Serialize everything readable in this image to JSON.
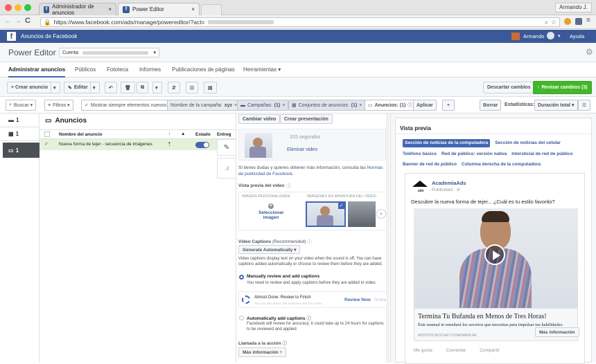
{
  "browser": {
    "tabs": [
      {
        "label": "Administrador de anuncios"
      },
      {
        "label": "Power Editor"
      }
    ],
    "url": "https://www.facebook.com/ads/manage/powereditor/?act=",
    "user": "Armando J."
  },
  "fbbar": {
    "title": "Anuncios de Facebook",
    "user": "Armando",
    "help": "Ayuda"
  },
  "pe": {
    "title": "Power Editor",
    "account_label": "Cuenta:"
  },
  "menu": [
    "Administrar anuncios",
    "Públicos",
    "Fototeca",
    "Informes",
    "Publicaciones de páginas",
    "Herramientas ▾"
  ],
  "toolbar": {
    "create": "+ Crear anuncio",
    "edit": "Editar",
    "discard": "Descartar cambios",
    "review": "Revisar cambios (3)"
  },
  "filters": {
    "search": "Buscar ▾",
    "filters": "Filtros ▾",
    "always_show": "Mostrar siempre elementos nuevos",
    "campaign_name": "Nombre de la campaña:",
    "campaign_name_val": "xyz",
    "campaigns": "Campañas:",
    "campaigns_val": "(1)",
    "adsets": "Conjuntos de anuncios:",
    "adsets_val": "(1)",
    "ads": "Anuncios: (1)",
    "apply": "Aplicar",
    "clear": "Borrar",
    "stats": "Estadísticas:",
    "stats_val": "Duración total ▾"
  },
  "left": {
    "count1": "1",
    "count2": "1",
    "count3": "1"
  },
  "adlist": {
    "title": "Anuncios",
    "headers": [
      "Nombre del anuncio",
      "Estado",
      "Entreg"
    ],
    "row": {
      "name": "Nueva forma de tejer - secuencia de imágenes"
    }
  },
  "editor": {
    "change_video": "Cambiar video",
    "create_presentation": "Crear presentación",
    "seconds": "· 315 segundos",
    "remove": "Eliminar video",
    "help_text": "Si tienes dudas y quieres obtener más información, consulta las",
    "help_link": "Normas de publicidad de Facebook.",
    "preview_label": "Vista previa del video",
    "custom_image": "IMAGEN PERSONALIZADA",
    "thumbs": "IMÁGENES EN MINIATURA DEL VIDEO",
    "select_image": "Seleccionar imagen",
    "captions_label": "Video Captions",
    "captions_rec": "(Recommended)",
    "captions_select": "Generate Automatically ▾",
    "captions_desc": "Video captions display text on your video when the sound is off. You can have captions added automatically or choose to review them before they are added.",
    "opt1_title": "Manually review and add captions",
    "opt1_desc": "You need to review and apply captions before they are added to video.",
    "done_title": "Almost Done: Review to Finish",
    "done_sub": "You can also share with someone else for review",
    "review_now": "Review Now",
    "share": "Share",
    "opt2_title": "Automatically add captions",
    "opt2_desc": "Facebook will review for accuracy. It could take up to 24 hours for captions to be reviewed and applied",
    "cta_label": "Llamada a la acción",
    "cta_val": "Más información ÷"
  },
  "preview": {
    "title": "Vista previa",
    "tabs": [
      "Sección de noticias de la computadora",
      "Sección de noticias del celular",
      "Teléfono básico",
      "Red de público: versión nativa",
      "Intersticial de red de público",
      "Banner de red de público",
      "Columna derecha de la computadora"
    ],
    "page": "AcademiaAds",
    "sponsored": "Publicidad · ⊘",
    "text": "Descubre la nueva forma de tejer... ¿Cuál es tu estilo favorito?",
    "headline": "Termina Tu Bufanda en Menos de Tres Horas!",
    "desc": "Éste manual te enseñará los secretos que necesitas para impulsar tus habilidades.",
    "domain": "MISITIOCROCHET.COM/MANUAL",
    "cta": "Más información",
    "actions": [
      "Me gusta",
      "Comentar",
      "Compartir"
    ]
  }
}
